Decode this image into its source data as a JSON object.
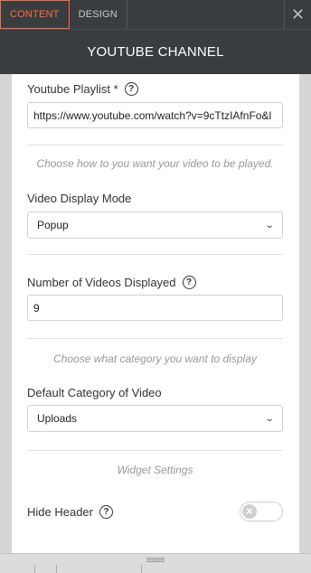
{
  "tabs": [
    {
      "label": "CONTENT",
      "active": true
    },
    {
      "label": "DESIGN",
      "active": false
    }
  ],
  "header": {
    "title": "YOUTUBE CHANNEL"
  },
  "form": {
    "playlist": {
      "label": "Youtube Playlist *",
      "value": "https://www.youtube.com/watch?v=9cTtzIAfnFo&l"
    },
    "play_hint": "Choose how to you want your video to be played.",
    "display_mode": {
      "label": "Video Display Mode",
      "value": "Popup"
    },
    "num_videos": {
      "label": "Number of Videos Displayed",
      "value": "9"
    },
    "category_hint": "Choose what category you want to display",
    "category": {
      "label": "Default Category of Video",
      "value": "Uploads"
    },
    "widget_settings": "Widget Settings",
    "hide_header": {
      "label": "Hide Header",
      "enabled": false
    }
  },
  "colors": {
    "accent": "#ff6a3d",
    "topbar": "#3a3d3f"
  },
  "icons": {
    "close": "close-icon",
    "help": "help-icon",
    "chevron": "chevron-down-icon"
  }
}
